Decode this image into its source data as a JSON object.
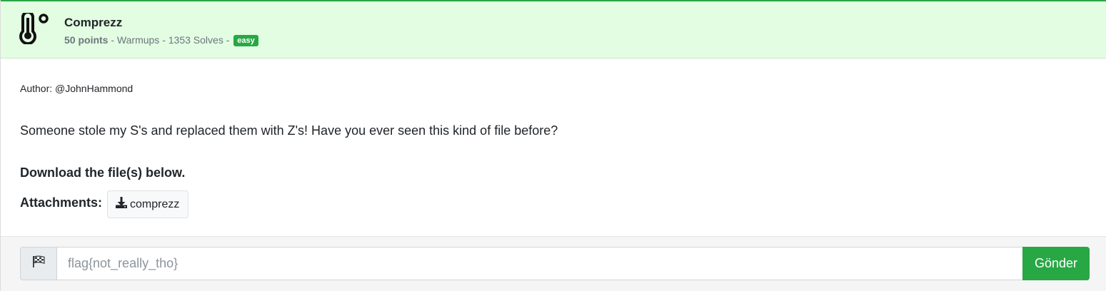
{
  "challenge": {
    "category_icon": "thermometer-icon",
    "title": "Comprezz",
    "points": "50 points",
    "separator1": " - ",
    "category": "Warmups",
    "separator2": " - ",
    "solves": "1353 Solves",
    "separator3": " - ",
    "difficulty": "easy"
  },
  "body": {
    "author": "Author: @JohnHammond",
    "description": "Someone stole my S's and replaced them with Z's! Have you ever seen this kind of file before?",
    "download_text": "Download the file(s) below.",
    "attachments_label": "Attachments:",
    "attachment": {
      "icon": "download-icon",
      "name": "comprezz"
    }
  },
  "submission": {
    "flag_icon": "checkered-flag-icon",
    "placeholder": "flag{not_really_tho}",
    "submit_label": "Gönder"
  },
  "colors": {
    "header_bg": "#e2fde2",
    "accent": "#28a745"
  }
}
